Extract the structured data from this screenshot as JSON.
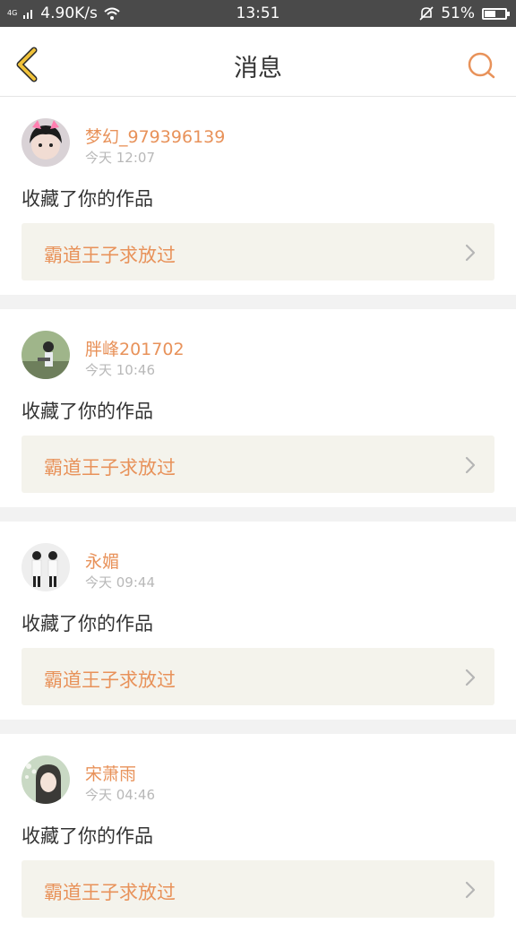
{
  "status_bar": {
    "network": "4G",
    "speed": "4.90K/s",
    "time": "13:51",
    "battery": "51%",
    "battery_level": 0.51
  },
  "header": {
    "title": "消息",
    "back_icon": "back-chevron-icon",
    "search_icon": "search-icon"
  },
  "messages": [
    {
      "user": "梦幻_979396139",
      "time": "今天 12:07",
      "action": "收藏了你的作品",
      "work": "霸道王子求放过"
    },
    {
      "user": "胖峰201702",
      "time": "今天 10:46",
      "action": "收藏了你的作品",
      "work": "霸道王子求放过"
    },
    {
      "user": "永媚",
      "time": "今天 09:44",
      "action": "收藏了你的作品",
      "work": "霸道王子求放过"
    },
    {
      "user": "宋萧雨",
      "time": "今天 04:46",
      "action": "收藏了你的作品",
      "work": "霸道王子求放过"
    }
  ],
  "colors": {
    "accent": "#e8925a",
    "text": "#333333",
    "muted": "#b8b8b8",
    "card_bg": "#f4f3ec",
    "divider": "#f2f2f2",
    "status_bar": "#4a4a4a",
    "back_icon": "#f0c23a"
  }
}
